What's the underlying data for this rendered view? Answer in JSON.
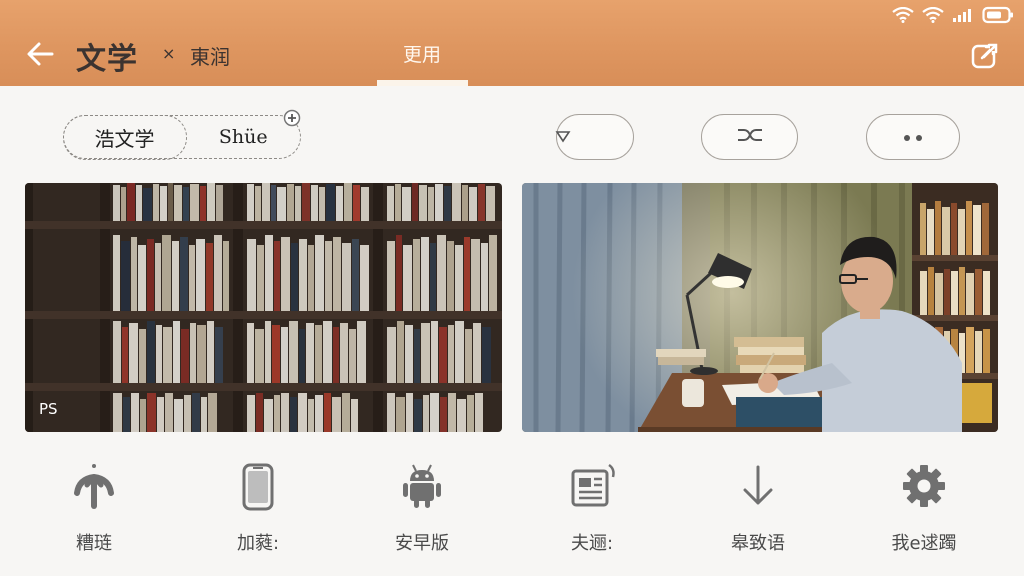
{
  "status_bar": {
    "icons": [
      "wifi-icon",
      "wifi-icon",
      "signal-icon",
      "battery-icon"
    ]
  },
  "header": {
    "title": "文学",
    "close_glyph": "×",
    "subtitle": "東润",
    "tab_label": "更用",
    "back_icon": "back-arrow-icon",
    "share_icon": "share-icon"
  },
  "filters": {
    "chip_primary": "浩文学",
    "chip_secondary": "Shüe",
    "badge_icon": "add-badge-icon",
    "pills": [
      {
        "icon": "caret-left-icon"
      },
      {
        "icon": "shuffle-icon"
      },
      {
        "icon": "more-dots-icon"
      }
    ]
  },
  "cards": [
    {
      "scene": "bookshelf-photo",
      "overlay_text": "PS"
    },
    {
      "scene": "reading-at-desk-photo"
    }
  ],
  "actions": [
    {
      "icon": "upload-arrow-icon",
      "label": "糟琏"
    },
    {
      "icon": "phone-icon",
      "label": "加蕤:"
    },
    {
      "icon": "android-icon",
      "label": "安早版"
    },
    {
      "icon": "news-icon",
      "label": "夫逦:"
    },
    {
      "icon": "download-icon",
      "label": "皋致语"
    },
    {
      "icon": "settings-gear-icon",
      "label": "我e逑躅"
    }
  ],
  "colors": {
    "header_bg": "#de9660",
    "header_text": "#3b3330",
    "page_bg": "#f7f6f4",
    "icon_gray": "#707070"
  }
}
